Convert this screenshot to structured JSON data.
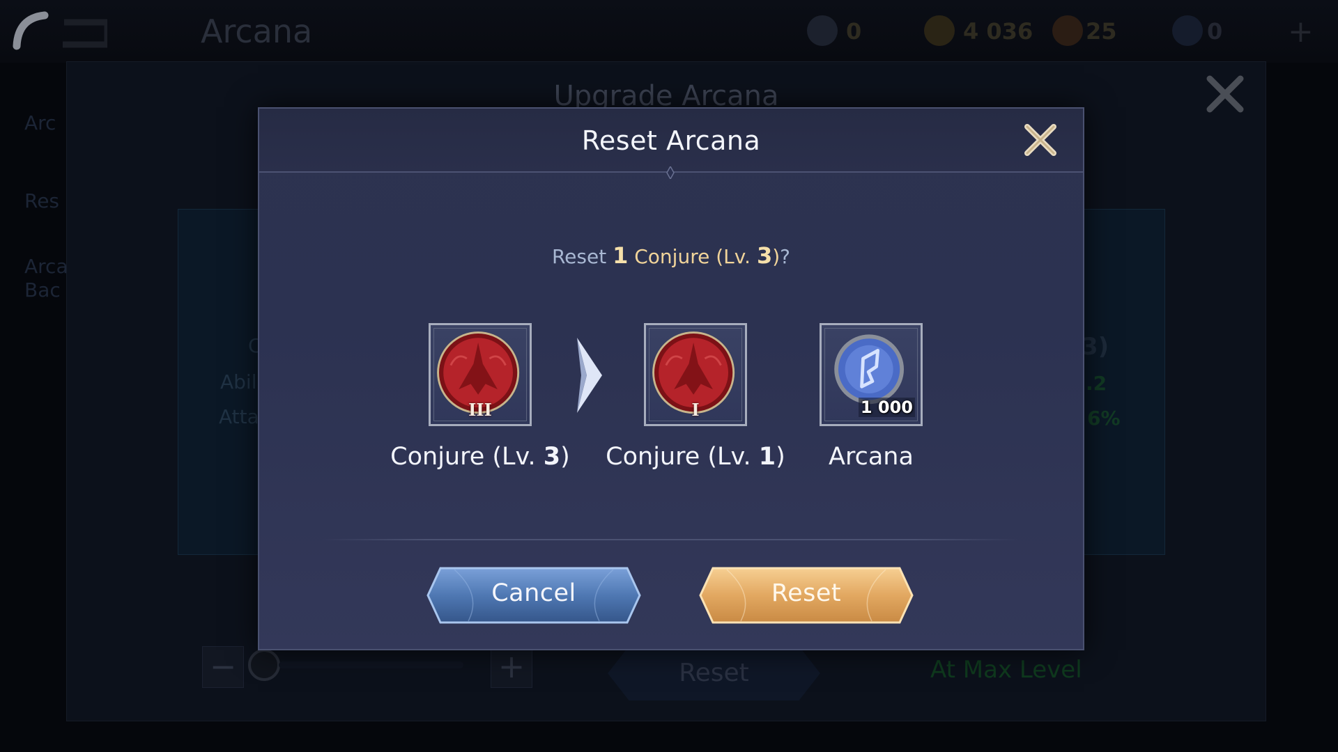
{
  "background": {
    "title": "Arcana",
    "currencies": [
      {
        "icon": "ticket-icon",
        "value": "0"
      },
      {
        "icon": "battle-point-coin-icon",
        "value": "4 036"
      },
      {
        "icon": "diamond-icon",
        "value": "25"
      },
      {
        "icon": "fragment-icon",
        "value": "0"
      }
    ],
    "panel_title": "Upgrade Arcana",
    "sidebar": {
      "item_1": "Arc",
      "item_2": "Res",
      "item_3_line1": "Arca",
      "item_3_line2": "Bac"
    },
    "card": {
      "left_title": "C",
      "left_line1": "Abil",
      "left_line2": "Atta",
      "right_title": "3)",
      "right_line1": ".2",
      "right_line2": "6%"
    },
    "minus_label": "−",
    "plus_label": "+",
    "reset_label": "Reset",
    "max_level_label": "At Max Level"
  },
  "dialog": {
    "title": "Reset Arcana",
    "question": {
      "prefix": "Reset ",
      "count": "1",
      "item_name": " Conjure (Lv. ",
      "level": "3",
      "suffix_close": ")",
      "suffix": "?"
    },
    "items": [
      {
        "icon": "conjure-arcana-icon",
        "numeral": "III",
        "name": "Conjure (Lv. ",
        "level": "3",
        "close": ")"
      },
      {
        "icon": "conjure-arcana-icon",
        "numeral": "I",
        "name": "Conjure (Lv. ",
        "level": "1",
        "close": ")"
      },
      {
        "icon": "arcana-currency-icon",
        "quantity": "1 000",
        "name": "Arcana"
      }
    ],
    "cancel_label": "Cancel",
    "reset_label": "Reset"
  },
  "colors": {
    "dialog_bg": "#2d3350",
    "highlight_text": "#f1d49a",
    "cancel_button": "#4f78b3",
    "reset_button": "#e2a861",
    "conjure_red": "#b5232a",
    "arcana_blue": "#4a6bc6"
  }
}
